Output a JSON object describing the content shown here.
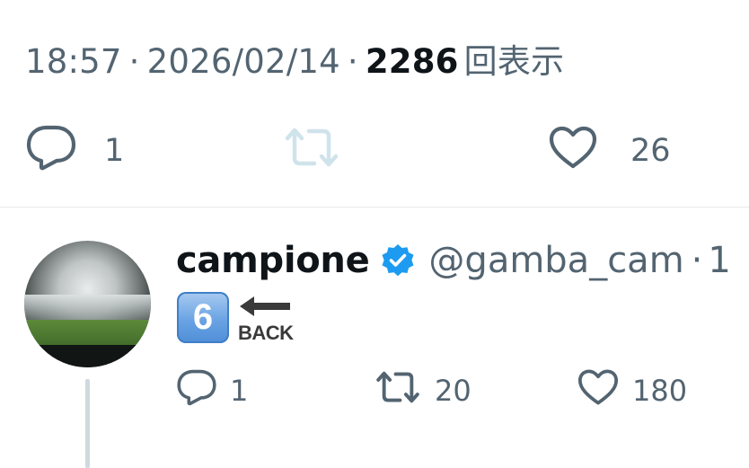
{
  "tweet_meta": {
    "time": "18:57",
    "separator": "·",
    "date": "2026/02/14",
    "views_count": "2286",
    "views_label": "回表示"
  },
  "tweet_actions": {
    "reply_count": "1",
    "like_count": "26"
  },
  "reply": {
    "display_name": "campione",
    "handle": "@gamba_cam",
    "dot": "·",
    "time_peek": "1",
    "emoji_keycap": "6",
    "emoji_back_label": "BACK",
    "reply_count": "1",
    "retweet_count": "20",
    "like_count": "180"
  },
  "colors": {
    "secondary_text": "#536471",
    "primary_text": "#0f1419",
    "verified_blue": "#1d9bf0",
    "retweet_disabled": "#cfe3ea",
    "divider": "#e6e9ea"
  },
  "icons": [
    "reply-icon",
    "retweet-icon",
    "like-icon",
    "verified-badge-icon",
    "keycap-six-emoji",
    "back-arrow-emoji"
  ]
}
